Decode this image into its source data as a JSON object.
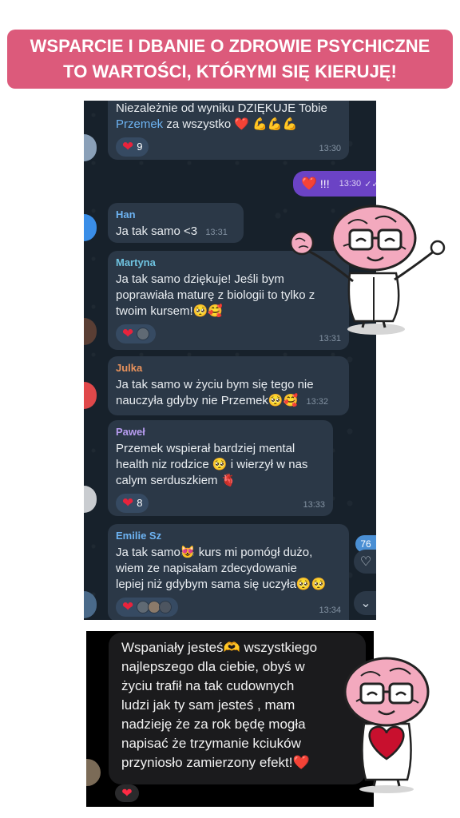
{
  "banner": {
    "line1": "WSPARCIE I DBANIE O ZDROWIE PSYCHICZNE",
    "line2": "TO WARTOŚCI, KTÓRYMI SIĘ KIERUJĘ!"
  },
  "chat": {
    "first_message": {
      "text_prefix": "Niezależnie od wyniku DZIĘKUJE Tobie",
      "mention": "Przemek",
      "text_suffix": "za wszystko ❤️ 💪💪💪",
      "reaction_count": "9",
      "time": "13:30"
    },
    "outgoing": {
      "text": "!!!",
      "time": "13:30",
      "status": "✓✓"
    },
    "messages": [
      {
        "name": "Han",
        "name_color": "#6db3f2",
        "text": "Ja tak samo <3",
        "time": "13:31"
      },
      {
        "name": "Martyna",
        "name_color": "#6fc3e0",
        "lines": [
          "Ja tak samo dziękuje! Jeśli bym",
          "poprawiała maturę z biologii to tylko z",
          "twoim kursem!🥺🥰"
        ],
        "time": "13:31"
      },
      {
        "name": "Julka",
        "name_color": "#e8925c",
        "lines": [
          "Ja tak samo w życiu bym się tego nie",
          "nauczyła gdyby nie Przemek🥺🥰"
        ],
        "time": "13:32"
      },
      {
        "name": "Paweł",
        "name_color": "#b79cf0",
        "lines": [
          "Przemek wspierał bardziej mental",
          "health niz rodzice 🥺 i wierzył w nas",
          "calym serduszkiem 🫀"
        ],
        "reaction_count": "8",
        "time": "13:33"
      },
      {
        "name": "Emilie Sz",
        "name_color": "#6db3f2",
        "lines": [
          "Ja tak samo😻 kurs mi pomógł dużo,",
          "wiem ze napisałam zdecydowanie",
          "lepiej niż gdybym sama się uczyła🥺🥺"
        ],
        "time": "13:34"
      }
    ],
    "unread_count": "76"
  },
  "second_chat": {
    "lines": [
      "Wspaniały jesteś🫶 wszystkiego",
      "najlepszego dla ciebie, obyś w",
      "życiu trafił na tak cudownych",
      "ludzi jak ty sam jesteś , mam",
      "nadzieję że za rok będę mogła",
      "napisać że trzymanie kciuków",
      "przyniosło zamierzony efekt!❤️"
    ]
  },
  "colors": {
    "banner": "#dc5a7b",
    "chat_bg": "#17212b",
    "bubble": "#2b3847",
    "outgoing": "#6b43c5",
    "brain_pink": "#f3a9be"
  },
  "icons": {
    "heart": "❤",
    "outgoing_heart": "❤️",
    "unread_heart": "♡",
    "scroll_down": "⌄"
  }
}
